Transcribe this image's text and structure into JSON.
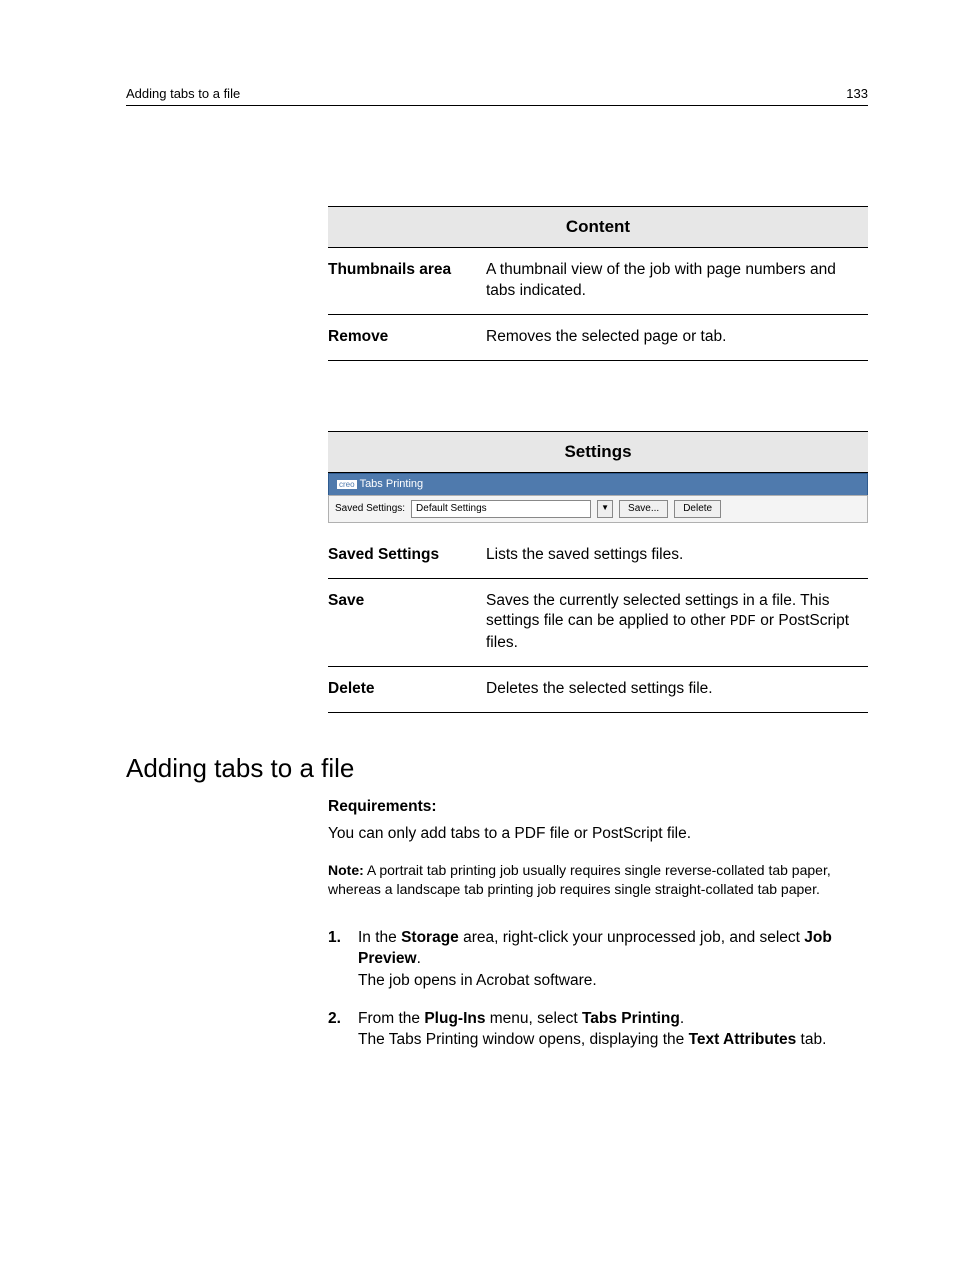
{
  "header": {
    "left": "Adding tabs to a file",
    "right": "133"
  },
  "tables": {
    "content": {
      "title": "Content",
      "rows": [
        {
          "k": "Thumbnails area",
          "v": "A thumbnail view of the job with page numbers and tabs indicated."
        },
        {
          "k": "Remove",
          "v": "Removes the selected page or tab."
        }
      ]
    },
    "settings": {
      "title": "Settings",
      "bar": {
        "window_title": "Tabs Printing",
        "label": "Saved Settings:",
        "value": "Default Settings",
        "save": "Save...",
        "delete": "Delete"
      },
      "rows": [
        {
          "k": "Saved Settings",
          "v": "Lists the saved settings files."
        },
        {
          "k": "Save",
          "v_pre": "Saves the currently selected settings in a file. This settings file can be applied to other ",
          "v_code": "PDF",
          "v_post": " or PostScript files."
        },
        {
          "k": "Delete",
          "v": "Deletes the selected settings file."
        }
      ]
    }
  },
  "section": {
    "title": "Adding tabs to a file",
    "requirements_label": "Requirements:",
    "requirements_text": "You can only add tabs to a PDF file or PostScript file.",
    "note_label": "Note:",
    "note_text": " A portrait tab printing job usually requires single reverse-collated tab paper, whereas a landscape tab printing job requires single straight-collated tab paper.",
    "steps": [
      {
        "parts": [
          {
            "t": "In the "
          },
          {
            "b": "Storage"
          },
          {
            "t": " area, right-click your unprocessed job, and select "
          },
          {
            "b": "Job Preview"
          },
          {
            "t": "."
          }
        ],
        "after": "The job opens in Acrobat software."
      },
      {
        "parts": [
          {
            "t": "From the "
          },
          {
            "b": "Plug-Ins"
          },
          {
            "t": " menu, select "
          },
          {
            "b": "Tabs Printing"
          },
          {
            "t": "."
          }
        ],
        "after_parts": [
          {
            "t": "The Tabs Printing window opens, displaying the "
          },
          {
            "b": "Text Attributes"
          },
          {
            "t": " tab."
          }
        ]
      }
    ]
  }
}
